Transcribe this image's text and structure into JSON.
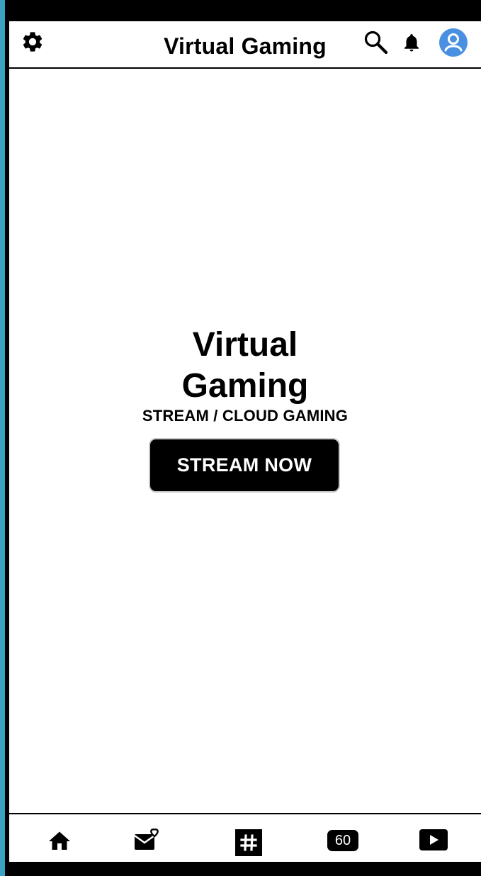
{
  "app": {
    "title": "Virtual Gaming"
  },
  "header": {
    "title": "Virtual Gaming",
    "icons": [
      "gear-icon",
      "search-icon",
      "bell-icon",
      "avatar-icon"
    ]
  },
  "hero": {
    "title": "Virtual Gaming",
    "subtitle": "STREAM / CLOUD GAMING",
    "cta_label": "STREAM NOW"
  },
  "bottom_nav": {
    "items": [
      {
        "icon": "home-icon"
      },
      {
        "icon": "mail-heart-icon"
      },
      {
        "icon": "hashtag-icon"
      },
      {
        "icon": "sixty-badge-icon",
        "label": "60"
      },
      {
        "icon": "play-icon"
      }
    ]
  },
  "colors": {
    "frame": "#000000",
    "background": "#3aa3c4",
    "screen": "#ffffff",
    "avatar": "#4a90e2",
    "button": "#000000",
    "button_text": "#ffffff"
  }
}
